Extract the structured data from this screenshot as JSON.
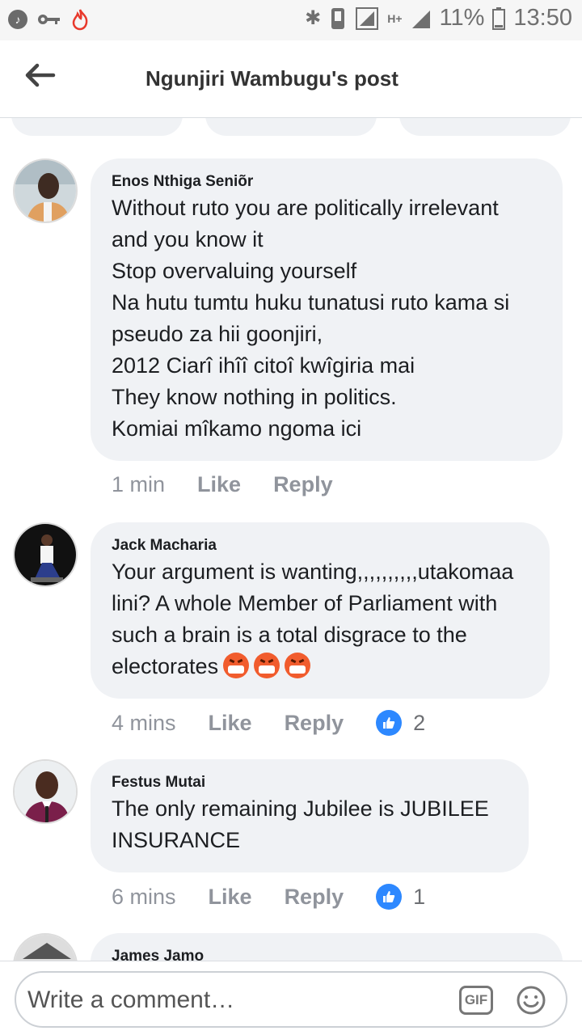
{
  "status_bar": {
    "battery": "11%",
    "time": "13:50",
    "network": "H+",
    "icons": [
      "music-icon",
      "key-icon",
      "fire-icon",
      "bluetooth-icon",
      "vibrate-icon",
      "signal-icon",
      "battery-icon"
    ]
  },
  "header": {
    "title": "Ngunjiri Wambugu's post",
    "back_icon": "arrow-left-icon"
  },
  "comments": [
    {
      "author": "Enos Nthiga Seniõr",
      "text": "Without ruto you are politically irrelevant\nand you know it\nStop overvaluing yourself\nNa hutu tumtu huku tunatusi ruto kama si\npseudo za hii goonjiri,\n2012 Ciarî ihîî citoî kwîgiria mai\nThey know nothing in politics.\nKomiai mîkamo ngoma ici",
      "time": "1 min",
      "like_label": "Like",
      "reply_label": "Reply",
      "reactions": null
    },
    {
      "author": "Jack Macharia",
      "text": "Your argument is wanting,,,,,,,,,,utakomaa\nlini? A whole Member of Parliament with\nsuch a brain is a total disgrace to the\nelectorates",
      "time": "4 mins",
      "like_label": "Like",
      "reply_label": "Reply",
      "reactions": "2",
      "emoji_count": 3
    },
    {
      "author": "Festus Mutai",
      "text": "The only remaining Jubilee is JUBILEE\nINSURANCE",
      "time": "6 mins",
      "like_label": "Like",
      "reply_label": "Reply",
      "reactions": "1"
    },
    {
      "author": "James Jamo",
      "text": "",
      "partial": true
    }
  ],
  "composer": {
    "placeholder": "Write a comment…",
    "gif_label": "GIF",
    "emoji_icon": "smiley-icon"
  },
  "colors": {
    "bubble": "#f0f2f5",
    "like_blue": "#2d88ff",
    "meta_gray": "#90949c"
  }
}
